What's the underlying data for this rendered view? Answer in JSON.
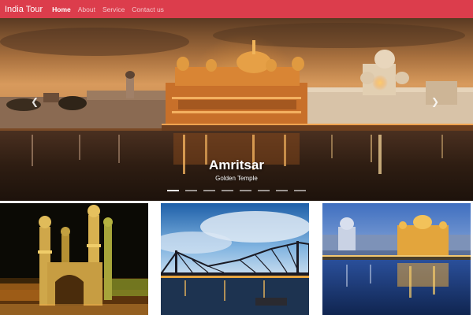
{
  "navbar": {
    "brand": "India Tour",
    "links": [
      {
        "label": "Home",
        "active": true
      },
      {
        "label": "About",
        "active": false
      },
      {
        "label": "Service",
        "active": false
      },
      {
        "label": "Contact us",
        "active": false
      }
    ],
    "color": "#dc3d4c"
  },
  "carousel": {
    "title": "Amritsar",
    "subtitle": "Golden Temple",
    "prev_icon": "chevron-left-icon",
    "next_icon": "chevron-right-icon",
    "indicators": 8,
    "active_indicator": 0
  },
  "thumbnails": [
    {
      "scene": "charminar-night"
    },
    {
      "scene": "howrah-bridge-dusk"
    },
    {
      "scene": "golden-temple-night"
    }
  ]
}
